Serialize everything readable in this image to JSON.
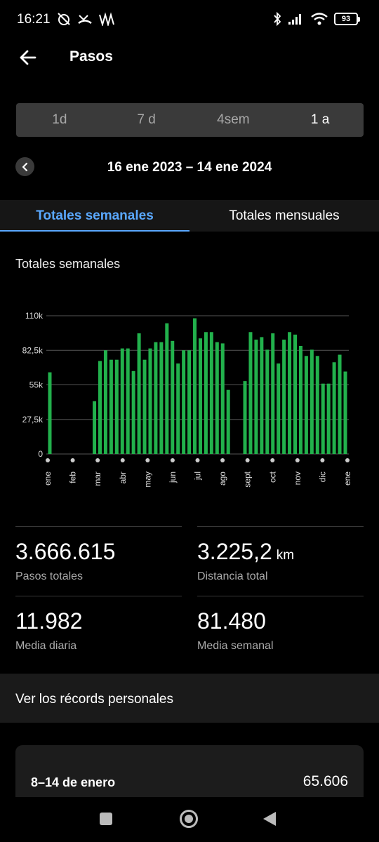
{
  "status_bar": {
    "time": "16:21",
    "battery": "93",
    "left_icons": [
      "alarm-off-icon",
      "missed-call-icon",
      "signal-wave-icon"
    ],
    "right_icons": [
      "bluetooth-icon",
      "cellular-signal-icon",
      "wifi-icon",
      "battery-icon"
    ]
  },
  "app_bar": {
    "title": "Pasos",
    "back_icon": "arrow-left-icon"
  },
  "range_selector": {
    "options": [
      "1d",
      "7 d",
      "4sem",
      "1 a"
    ],
    "selected": "1 a"
  },
  "date_nav": {
    "range": "16 ene 2023 – 14 ene 2024",
    "prev_icon": "chevron-left-icon"
  },
  "tabs": [
    {
      "label": "Totales semanales",
      "active": true
    },
    {
      "label": "Totales mensuales",
      "active": false
    }
  ],
  "chart_heading": "Totales semanales",
  "chart_data": {
    "type": "bar",
    "xlabel": "",
    "ylabel": "",
    "ylim": [
      0,
      110000
    ],
    "y_tick_labels": [
      "0",
      "27,5k",
      "55k",
      "82,5k",
      "110k"
    ],
    "y_tick_values": [
      0,
      27500,
      55000,
      82500,
      110000
    ],
    "month_labels": [
      "ene",
      "feb",
      "mar",
      "abr",
      "may",
      "jun",
      "jul",
      "ago",
      "sept",
      "oct",
      "nov",
      "dic",
      "ene"
    ],
    "bar_color": "#22b14c",
    "grid": true,
    "values": [
      65000,
      0,
      0,
      0,
      0,
      0,
      0,
      0,
      42000,
      74000,
      82500,
      75000,
      75000,
      84000,
      84000,
      66000,
      96000,
      75000,
      84000,
      89000,
      89000,
      104000,
      90000,
      72000,
      82500,
      82500,
      108000,
      92000,
      97000,
      97000,
      89000,
      88000,
      51000,
      0,
      0,
      58000,
      97000,
      91000,
      93000,
      83000,
      96000,
      72000,
      91000,
      97000,
      95000,
      86000,
      78000,
      83000,
      78000,
      56000,
      56000,
      73000,
      79000,
      65606
    ]
  },
  "stats": [
    {
      "value": "3.666.615",
      "unit": "",
      "label": "Pasos totales"
    },
    {
      "value": "3.225,2",
      "unit": "km",
      "label": "Distancia total"
    },
    {
      "value": "11.982",
      "unit": "",
      "label": "Media diaria"
    },
    {
      "value": "81.480",
      "unit": "",
      "label": "Media semanal"
    }
  ],
  "records_link": "Ver los récords personales",
  "week_row": {
    "label": "8–14 de enero",
    "value": "65.606"
  },
  "nav_bar": [
    "recents-square-icon",
    "home-circle-icon",
    "back-triangle-icon"
  ]
}
